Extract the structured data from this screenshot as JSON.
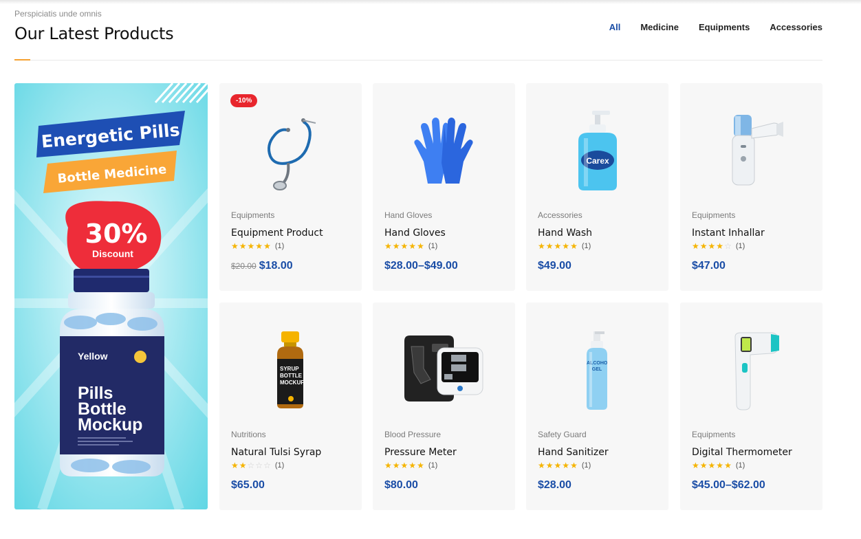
{
  "header": {
    "subtitle": "Perspiciatis unde omnis",
    "title": "Our Latest Products"
  },
  "tabs": [
    {
      "label": "All",
      "active": true
    },
    {
      "label": "Medicine",
      "active": false
    },
    {
      "label": "Equipments",
      "active": false
    },
    {
      "label": "Accessories",
      "active": false
    }
  ],
  "banner": {
    "line1": "Energetic Pills",
    "line2": "Bottle Medicine",
    "discount_value": "30%",
    "discount_label": "Discount",
    "bottle_brand": "Yellow",
    "bottle_line1": "Pills",
    "bottle_line2": "Bottle",
    "bottle_line3": "Mockup"
  },
  "colors": {
    "accent": "#1a4da6",
    "sale": "#e8262d",
    "star": "#f5b400",
    "orange": "#f5a030"
  },
  "products": [
    {
      "category": "Equipments",
      "name": "Equipment Product",
      "stars": 5,
      "count": "(1)",
      "old_price": "$20.00",
      "price": "$18.00",
      "badge": "-10%",
      "icon": "stethoscope-icon"
    },
    {
      "category": "Hand Gloves",
      "name": "Hand Gloves",
      "stars": 5,
      "count": "(1)",
      "price": "$28.00–$49.00",
      "icon": "gloves-icon"
    },
    {
      "category": "Accessories",
      "name": "Hand Wash",
      "stars": 5,
      "count": "(1)",
      "price": "$49.00",
      "icon": "hand-wash-icon",
      "label_text": "Carex"
    },
    {
      "category": "Equipments",
      "name": "Instant Inhallar",
      "stars": 4,
      "count": "(1)",
      "price": "$47.00",
      "icon": "inhaler-icon"
    },
    {
      "category": "Nutritions",
      "name": "Natural Tulsi Syrap",
      "stars": 2,
      "count": "(1)",
      "price": "$65.00",
      "icon": "syrup-bottle-icon",
      "label_text": "SYRUP BOTTLE MOCKUP"
    },
    {
      "category": "Blood Pressure",
      "name": "Pressure Meter",
      "stars": 5,
      "count": "(1)",
      "price": "$80.00",
      "icon": "blood-pressure-monitor-icon"
    },
    {
      "category": "Safety Guard",
      "name": "Hand Sanitizer",
      "stars": 5,
      "count": "(1)",
      "price": "$28.00",
      "icon": "sanitizer-bottle-icon",
      "label_text": "ALCOHOL GEL"
    },
    {
      "category": "Equipments",
      "name": "Digital Thermometer",
      "stars": 5,
      "count": "(1)",
      "price": "$45.00–$62.00",
      "icon": "thermometer-icon"
    }
  ]
}
